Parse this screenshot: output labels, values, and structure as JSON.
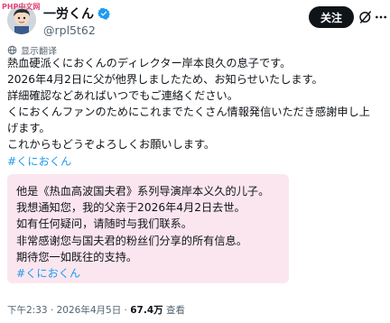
{
  "watermark": "PHP中文网",
  "author": {
    "name": "一労くん",
    "handle": "@rpl5t62"
  },
  "follow_label": "关注",
  "translate_label": "显示翻译",
  "post_lines": [
    "熱血硬派くにおくんのディレクター岸本良久の息子です。",
    "2026年4月2日に父が他界しましたため、お知らせいたします。",
    "詳細確認などあればいつでもご連絡ください。",
    "くにおくんファンのためにこれまでたくさん情報発信いただき感謝申し上",
    "げます。",
    "これからもどうぞよろしくお願いします。"
  ],
  "post_hashtag": "#くにおくん",
  "translation_lines": [
    "他是《热血高波国夫君》系列导演岸本义久的儿子。",
    "我想通知您，我的父亲于2026年4月2日去世。",
    "如有任何疑问，请随时与我们联系。",
    "非常感谢您与国夫君的粉丝们分享的所有信息。",
    "期待您一如既往的支持。"
  ],
  "translation_hashtag": "#くにおくん",
  "footer": {
    "time": "下午2:33",
    "sep1": " · ",
    "date": "2026年4月5日",
    "sep2": " · ",
    "views": "67.4万",
    "views_label": " 查看"
  },
  "colors": {
    "accent": "#1d9bf0",
    "verified": "#1d9bf0",
    "translation_bg": "#fbe6ef"
  },
  "icons": [
    "verified-badge-icon",
    "grok-icon",
    "more-options-icon",
    "globe-icon"
  ]
}
